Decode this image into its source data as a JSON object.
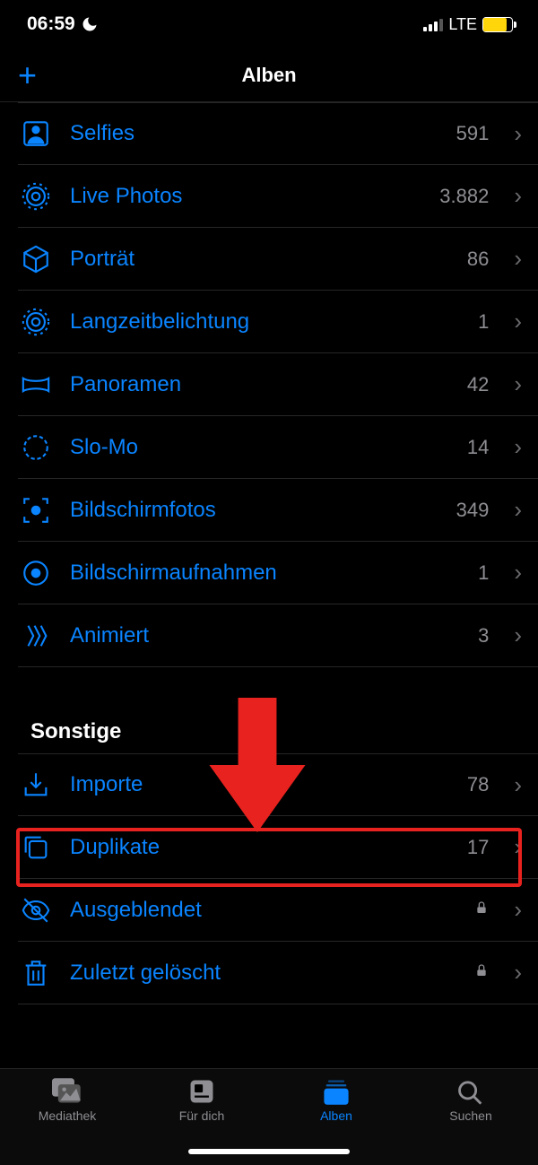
{
  "status": {
    "time": "06:59",
    "network": "LTE"
  },
  "nav": {
    "title": "Alben"
  },
  "media_types": {
    "items": [
      {
        "label": "Selfies",
        "count": "591",
        "icon": "selfies"
      },
      {
        "label": "Live Photos",
        "count": "3.882",
        "icon": "live"
      },
      {
        "label": "Porträt",
        "count": "86",
        "icon": "cube"
      },
      {
        "label": "Langzeitbelichtung",
        "count": "1",
        "icon": "live"
      },
      {
        "label": "Panoramen",
        "count": "42",
        "icon": "pano"
      },
      {
        "label": "Slo-Mo",
        "count": "14",
        "icon": "slomo"
      },
      {
        "label": "Bildschirmfotos",
        "count": "349",
        "icon": "screenshot"
      },
      {
        "label": "Bildschirmaufnahmen",
        "count": "1",
        "icon": "record"
      },
      {
        "label": "Animiert",
        "count": "3",
        "icon": "animated"
      }
    ]
  },
  "other": {
    "title": "Sonstige",
    "items": [
      {
        "label": "Importe",
        "count": "78",
        "icon": "import",
        "locked": false
      },
      {
        "label": "Duplikate",
        "count": "17",
        "icon": "duplicate",
        "locked": false
      },
      {
        "label": "Ausgeblendet",
        "count": "",
        "icon": "hidden",
        "locked": true
      },
      {
        "label": "Zuletzt gelöscht",
        "count": "",
        "icon": "trash",
        "locked": true
      }
    ]
  },
  "tabs": {
    "items": [
      {
        "label": "Mediathek",
        "active": false
      },
      {
        "label": "Für dich",
        "active": false
      },
      {
        "label": "Alben",
        "active": true
      },
      {
        "label": "Suchen",
        "active": false
      }
    ]
  }
}
